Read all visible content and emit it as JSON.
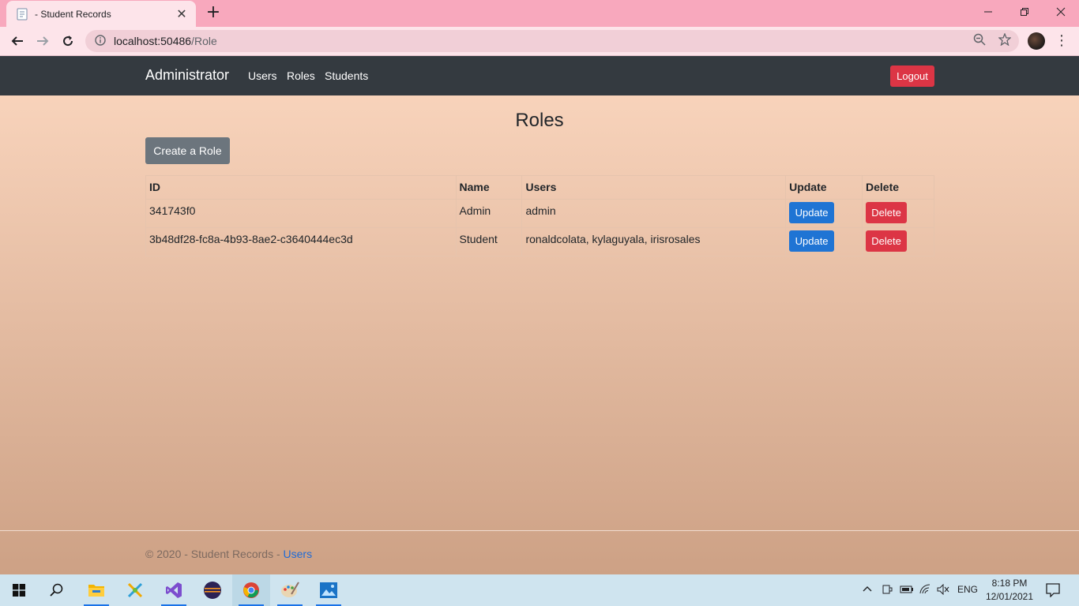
{
  "browser": {
    "tab_title": "- Student Records",
    "url_host": "localhost:50486",
    "url_path": "/Role"
  },
  "navbar": {
    "brand": "Administrator",
    "links": [
      "Users",
      "Roles",
      "Students"
    ],
    "logout_label": "Logout"
  },
  "page": {
    "title": "Roles",
    "create_label": "Create a Role"
  },
  "table": {
    "headers": [
      "ID",
      "Name",
      "Users",
      "Update",
      "Delete"
    ],
    "rows": [
      {
        "id": "341743f0",
        "name": "Admin",
        "users": "admin",
        "update": "Update",
        "delete": "Delete"
      },
      {
        "id": "3b48df28-fc8a-4b93-8ae2-c3640444ec3d",
        "name": "Student",
        "users": "ronaldcolata, kylaguyala, irisrosales",
        "update": "Update",
        "delete": "Delete"
      }
    ]
  },
  "footer": {
    "text": "© 2020 - Student Records - ",
    "link": "Users"
  },
  "taskbar": {
    "lang": "ENG",
    "time": "8:18 PM",
    "date": "12/01/2021"
  },
  "colors": {
    "navbar_bg": "#343a40",
    "danger": "#dc3545",
    "primary": "#1f74d4",
    "secondary": "#6c757d",
    "tab_strip": "#f8a8bd"
  }
}
